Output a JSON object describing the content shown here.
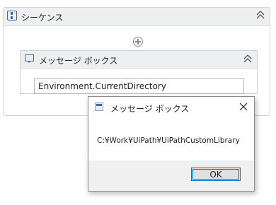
{
  "sequence": {
    "title": "シーケンス",
    "icon": "sequence-icon",
    "collapse_icon": "double-chevron-up-icon",
    "add_icon": "add-activity-icon"
  },
  "message_box_activity": {
    "title": "メッセージ ボックス",
    "icon": "message-box-icon",
    "collapse_icon": "double-chevron-up-icon",
    "expression": "Environment.CurrentDirectory"
  },
  "dialog": {
    "title": "メッセージ ボックス",
    "app_icon": "window-app-icon",
    "close_icon": "close-icon",
    "message": "C:¥Work¥UiPath¥UiPathCustomLibrary",
    "ok_label": "OK"
  },
  "colors": {
    "accent": "#0078d7",
    "activity_icon": "#3f67b5",
    "header_bg": "#eeeff1",
    "dialog_footer_bg": "#f0f0f0"
  }
}
